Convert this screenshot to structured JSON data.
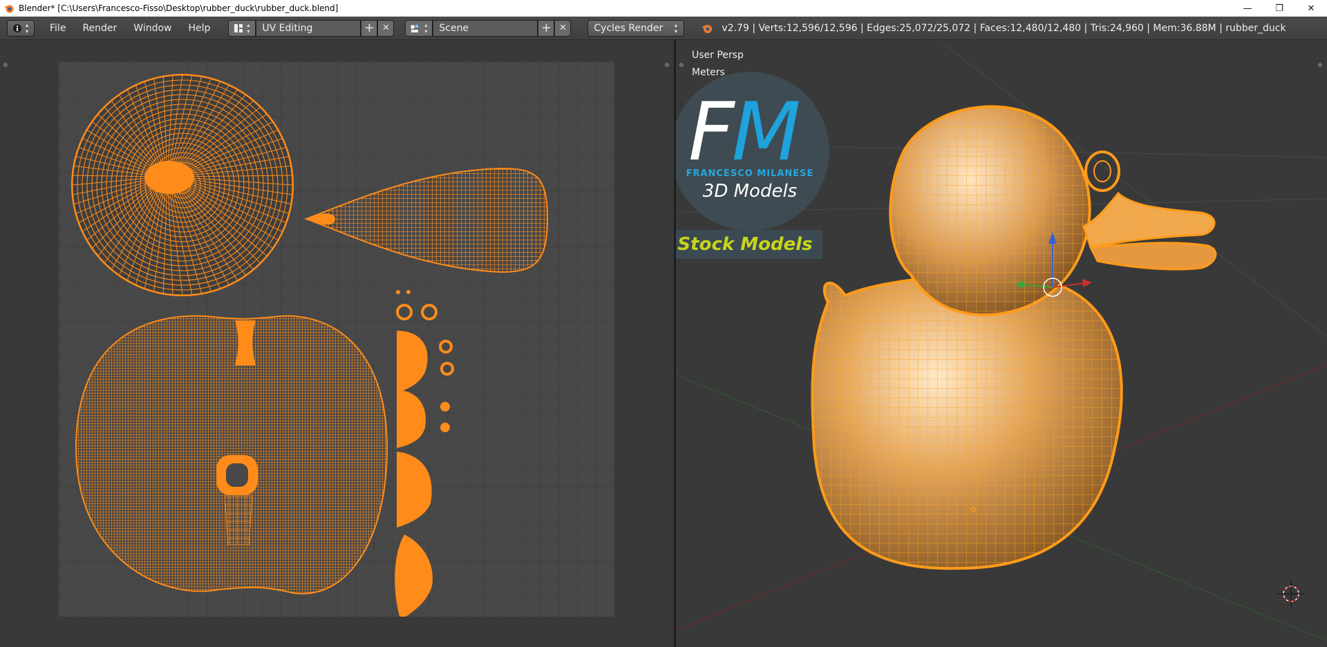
{
  "window": {
    "title": "Blender* [C:\\Users\\Francesco-Fisso\\Desktop\\rubber_duck\\rubber_duck.blend]",
    "minimize_glyph": "—",
    "maximize_glyph": "❐",
    "close_glyph": "✕"
  },
  "header": {
    "editor_type_icon": "info-icon",
    "menus": [
      "File",
      "Render",
      "Window",
      "Help"
    ],
    "screen_layout": "UV Editing",
    "scene": "Scene",
    "render_engine": "Cycles Render",
    "stats": "v2.79 | Verts:12,596/12,596 | Edges:25,072/25,072 | Faces:12,480/12,480 | Tris:24,960 | Mem:36.88M | rubber_duck",
    "add_glyph": "+",
    "remove_glyph": "✕",
    "dropdown_glyph": "▴▾"
  },
  "viewport": {
    "view_label": "User Persp",
    "units_label": "Meters"
  },
  "watermark": {
    "f": "F",
    "m": "M",
    "name": "FRANCESCO MILANESE",
    "subtitle": "3D Models",
    "stock": "Stock Models"
  },
  "colors": {
    "accent_orange": "#ff8c1a",
    "uv_grid_bg": "#444444",
    "duck_body": "#f0b25a"
  }
}
